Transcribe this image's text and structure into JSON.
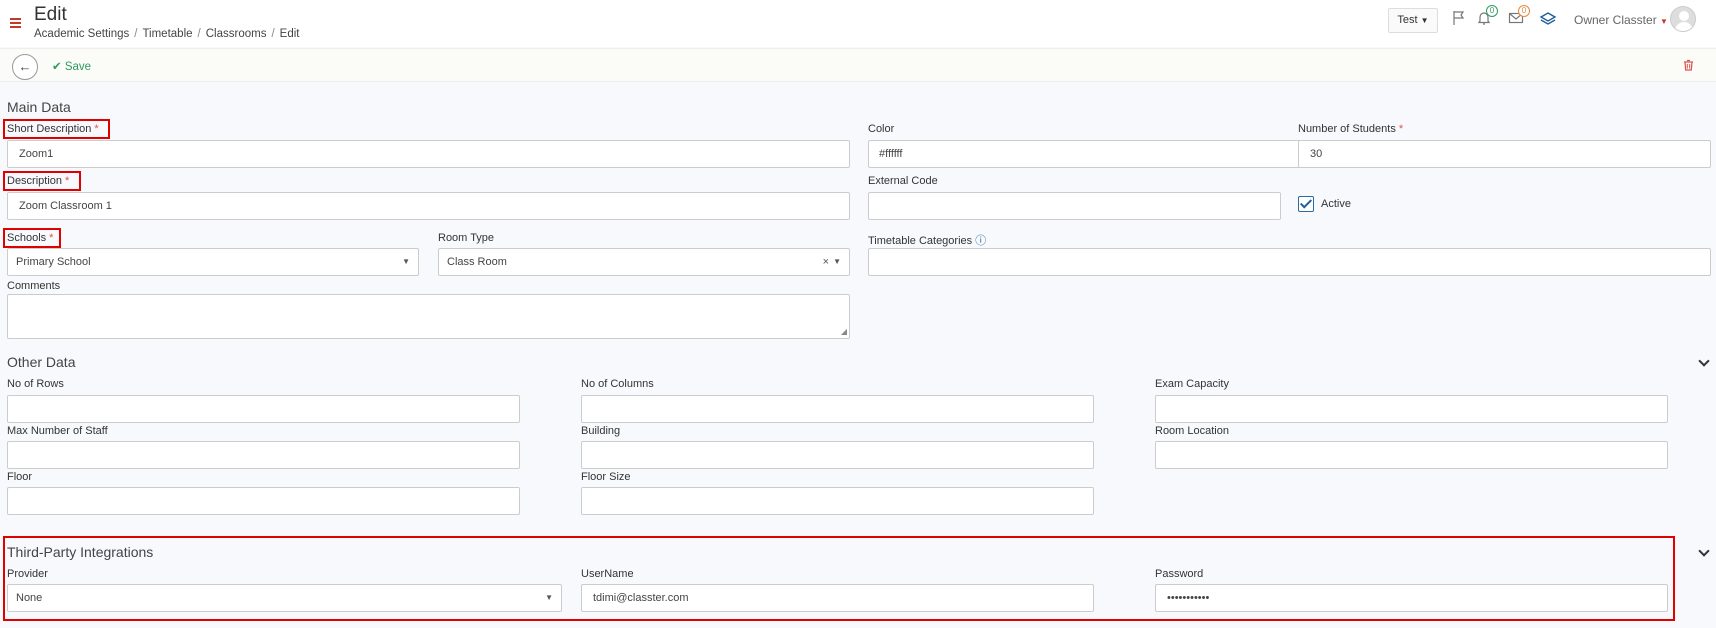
{
  "header": {
    "title": "Edit",
    "breadcrumb": [
      "Academic Settings",
      "Timetable",
      "Classrooms",
      "Edit"
    ],
    "env_button": "Test",
    "notifications_count": "0",
    "messages_count": "0",
    "user_name": "Owner Classter",
    "icons": [
      "menu-icon",
      "flag-icon",
      "bell-icon",
      "envelope-icon",
      "layers-icon"
    ]
  },
  "toolbar": {
    "save_label": "Save"
  },
  "main": {
    "section_title": "Main Data",
    "short_description": {
      "label": "Short Description",
      "value": "Zoom1"
    },
    "color": {
      "label": "Color",
      "value": "#ffffff"
    },
    "number_of_students": {
      "label": "Number of Students",
      "value": "30"
    },
    "description": {
      "label": "Description",
      "value": "Zoom Classroom 1"
    },
    "external_code": {
      "label": "External Code",
      "value": ""
    },
    "active": {
      "label": "Active",
      "checked": true
    },
    "schools": {
      "label": "Schools",
      "value": "Primary School"
    },
    "room_type": {
      "label": "Room Type",
      "value": "Class Room"
    },
    "timetable_categories": {
      "label": "Timetable Categories",
      "info": "ⓘ",
      "value": ""
    },
    "comments": {
      "label": "Comments",
      "value": ""
    },
    "required_mark": "*"
  },
  "other": {
    "section_title": "Other Data",
    "no_of_rows": "No of Rows",
    "no_of_columns": "No of Columns",
    "exam_capacity": "Exam Capacity",
    "max_staff": "Max Number of Staff",
    "building": "Building",
    "room_location": "Room Location",
    "floor": "Floor",
    "floor_size": "Floor Size"
  },
  "third_party": {
    "section_title": "Third-Party Integrations",
    "provider": {
      "label": "Provider",
      "value": "None"
    },
    "username": {
      "label": "UserName",
      "value": "tdimi@classter.com"
    },
    "password": {
      "label": "Password",
      "value": "•••••••••••"
    }
  },
  "colors": {
    "accent_red": "#c0392b",
    "save_green": "#2e9b5e",
    "highlight_red": "#e00000",
    "link_blue": "#1e5e9a"
  }
}
